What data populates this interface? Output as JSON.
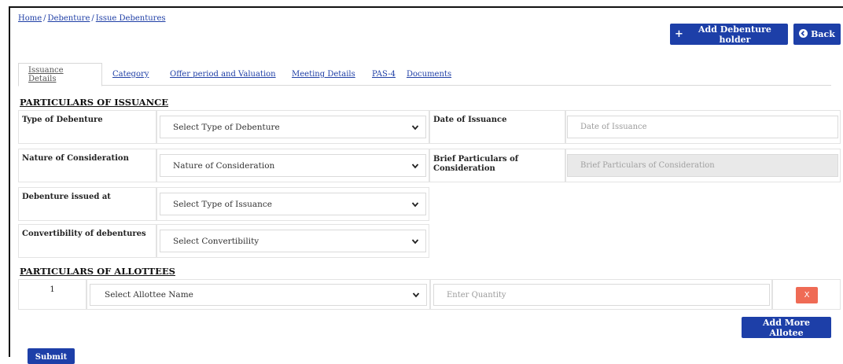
{
  "breadcrumb": {
    "home": "Home",
    "debenture": "Debenture",
    "issue": "Issue Debentures",
    "separator": "/"
  },
  "header": {
    "add_holder_label": "Add Debenture holder",
    "back_label": "Back"
  },
  "tabs": [
    {
      "label": "Issuance Details",
      "active": true
    },
    {
      "label": "Category"
    },
    {
      "label": "Offer period and Valuation"
    },
    {
      "label": "Meeting Details"
    },
    {
      "label": "PAS-4"
    },
    {
      "label": "Documents"
    }
  ],
  "issuance": {
    "title": "PARTICULARS OF ISSUANCE",
    "type_label": "Type of Debenture",
    "type_value": "Select Type of Debenture",
    "date_label": "Date of Issuance",
    "date_placeholder": "Date of Issuance",
    "nature_label": "Nature of Consideration",
    "nature_value": "Nature of Consideration",
    "brief_label": "Brief Particulars of Consideration",
    "brief_placeholder": "Brief Particulars of Consideration",
    "issued_at_label": "Debenture issued at",
    "issued_at_value": "Select Type of Issuance",
    "convert_label": "Convertibility of debentures",
    "convert_value": "Select Convertibility"
  },
  "allottees": {
    "title": "PARTICULARS OF ALLOTTEES",
    "rows": [
      {
        "index": "1",
        "name_value": "Select Allottee Name",
        "qty_placeholder": "Enter Quantity",
        "remove_label": "X"
      }
    ],
    "add_more_label": "Add More Allotee"
  },
  "footer": {
    "submit_label": "Submit"
  }
}
